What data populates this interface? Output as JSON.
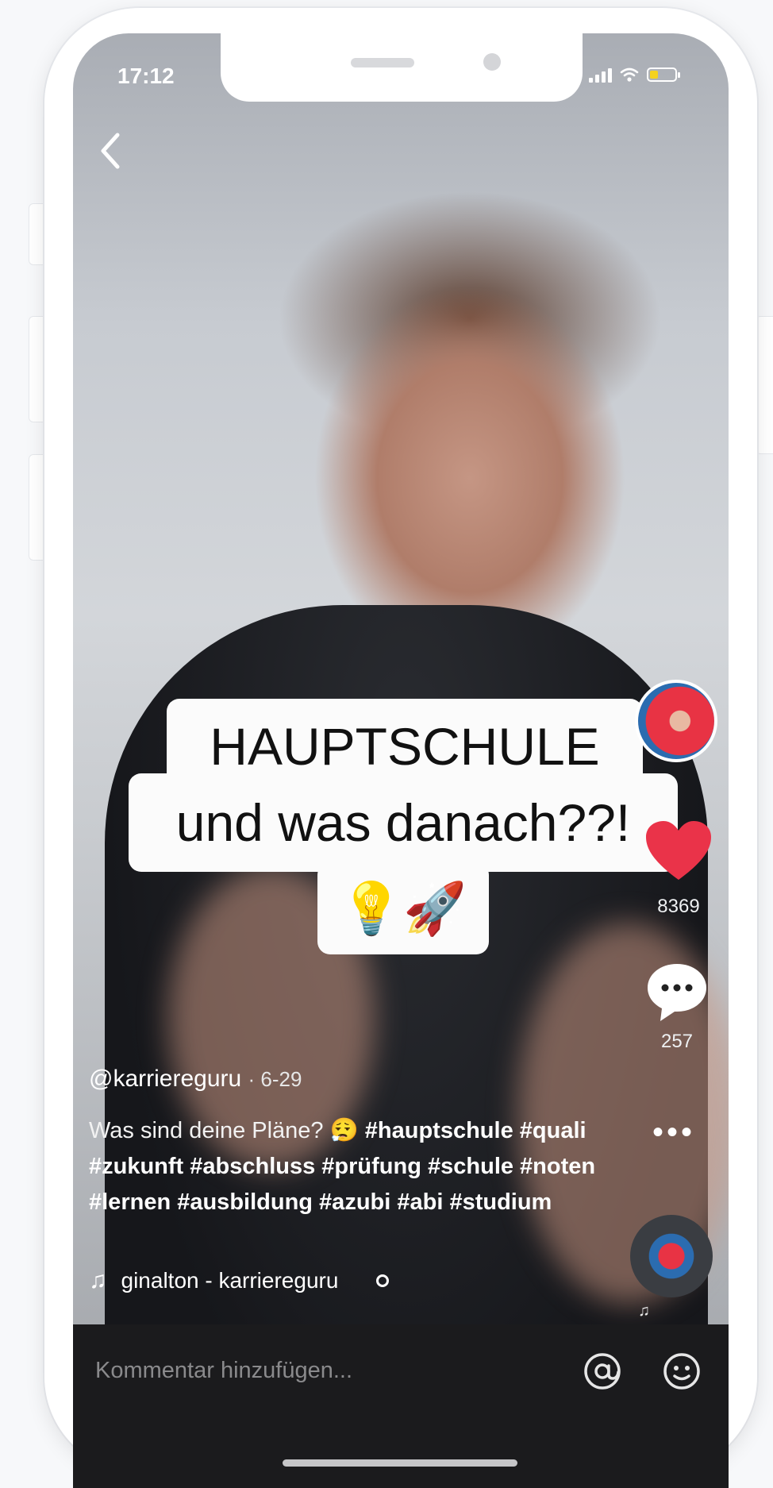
{
  "status_bar": {
    "time": "17:12"
  },
  "caption": {
    "line1": "HAUPTSCHULE",
    "line2": "und was danach??!",
    "emojis": "💡🚀"
  },
  "rail": {
    "likes": "8369",
    "comments": "257",
    "more": "•••"
  },
  "post": {
    "username": "@karriereguru",
    "date": "· 6-29",
    "text": "Was sind deine Pläne? 😮‍💨",
    "hashtags": "#hauptschule #quali #zukunft #abschluss #prüfung #schule #noten #lernen #ausbildung #azubi #abi #studium",
    "music": "ginalton - karriereguru"
  },
  "comment_bar": {
    "placeholder": "Kommentar hinzufügen..."
  },
  "colors": {
    "accent_heart": "#ea3349",
    "battery": "#f4d21f"
  }
}
